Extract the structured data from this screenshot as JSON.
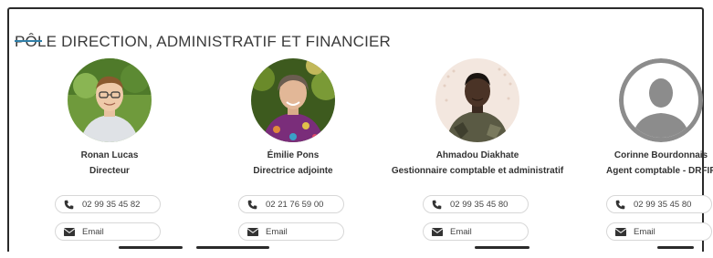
{
  "section": {
    "title": "PÔLE DIRECTION, ADMINISTRATIF ET FINANCIER"
  },
  "colors": {
    "accent": "#2f7fa8"
  },
  "people": [
    {
      "name": "Ronan Lucas",
      "role": "Directeur",
      "phone": "02 99 35 45 82",
      "email_label": "Email",
      "avatar": "photo"
    },
    {
      "name": "Émilie Pons",
      "role": "Directrice adjointe",
      "phone": "02 21 76 59 00",
      "email_label": "Email",
      "avatar": "photo"
    },
    {
      "name": "Ahmadou Diakhate",
      "role": "Gestionnaire comptable et administratif",
      "phone": "02 99 35 45 80",
      "email_label": "Email",
      "avatar": "photo"
    },
    {
      "name": "Corinne Bourdonnais",
      "role": "Agent comptable - DRFIP",
      "phone": "02 99 35 45 80",
      "email_label": "Email",
      "avatar": "placeholder"
    }
  ]
}
